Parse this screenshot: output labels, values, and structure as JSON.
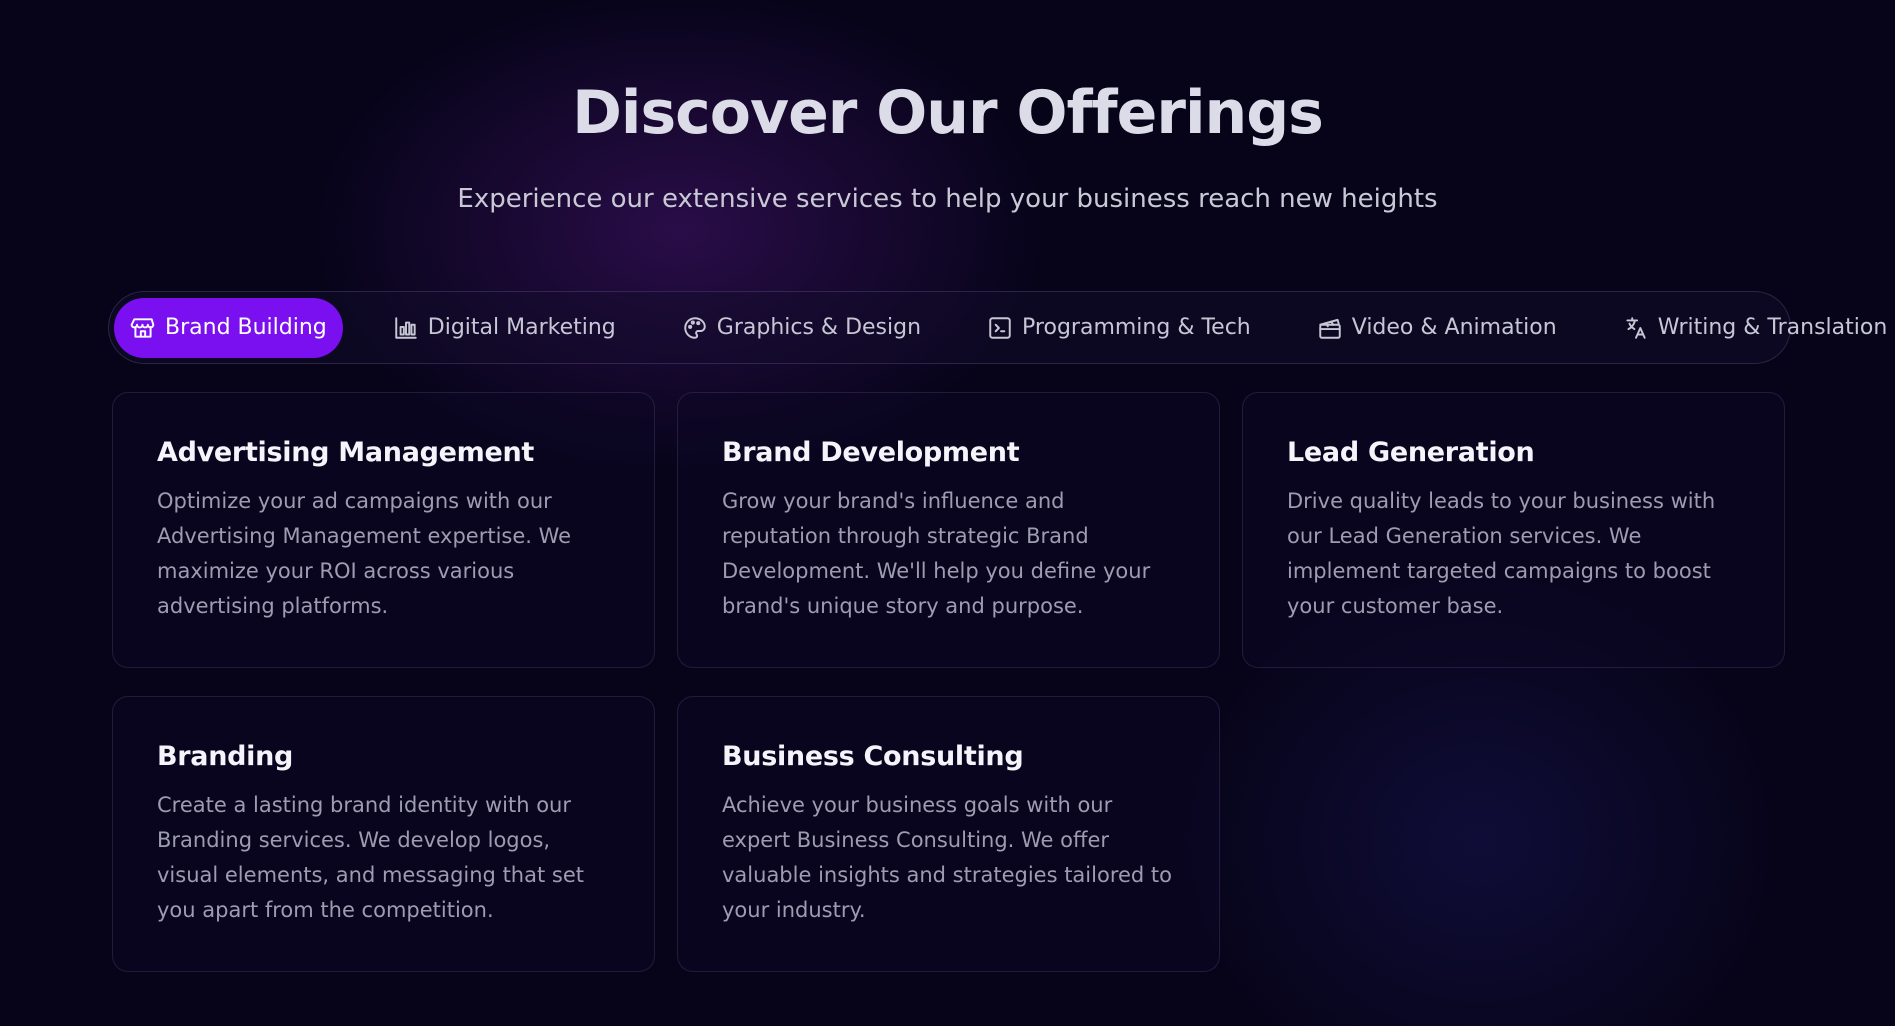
{
  "header": {
    "title": "Discover Our Offerings",
    "subtitle": "Experience our extensive services to help your business reach new heights"
  },
  "tabs": [
    {
      "label": "Brand Building",
      "icon": "store-icon",
      "active": true
    },
    {
      "label": "Digital Marketing",
      "icon": "bar-chart-icon",
      "active": false
    },
    {
      "label": "Graphics & Design",
      "icon": "palette-icon",
      "active": false
    },
    {
      "label": "Programming & Tech",
      "icon": "terminal-icon",
      "active": false
    },
    {
      "label": "Video & Animation",
      "icon": "clapperboard-icon",
      "active": false
    },
    {
      "label": "Writing & Translation",
      "icon": "translate-icon",
      "active": false
    }
  ],
  "cards": [
    {
      "title": "Advertising Management",
      "text": "Optimize your ad campaigns with our Advertising Management expertise. We maximize your ROI across various advertising platforms."
    },
    {
      "title": "Brand Development",
      "text": "Grow your brand's influence and reputation through strategic Brand Development. We'll help you define your brand's unique story and purpose."
    },
    {
      "title": "Lead Generation",
      "text": "Drive quality leads to your business with our Lead Generation services. We implement targeted campaigns to boost your customer base."
    },
    {
      "title": "Branding",
      "text": "Create a lasting brand identity with our Branding services. We develop logos, visual elements, and messaging that set you apart from the competition."
    },
    {
      "title": "Business Consulting",
      "text": "Achieve your business goals with our expert Business Consulting. We offer valuable insights and strategies tailored to your industry."
    }
  ],
  "colors": {
    "background": "#07041a",
    "accent": "#7a0ff0"
  }
}
